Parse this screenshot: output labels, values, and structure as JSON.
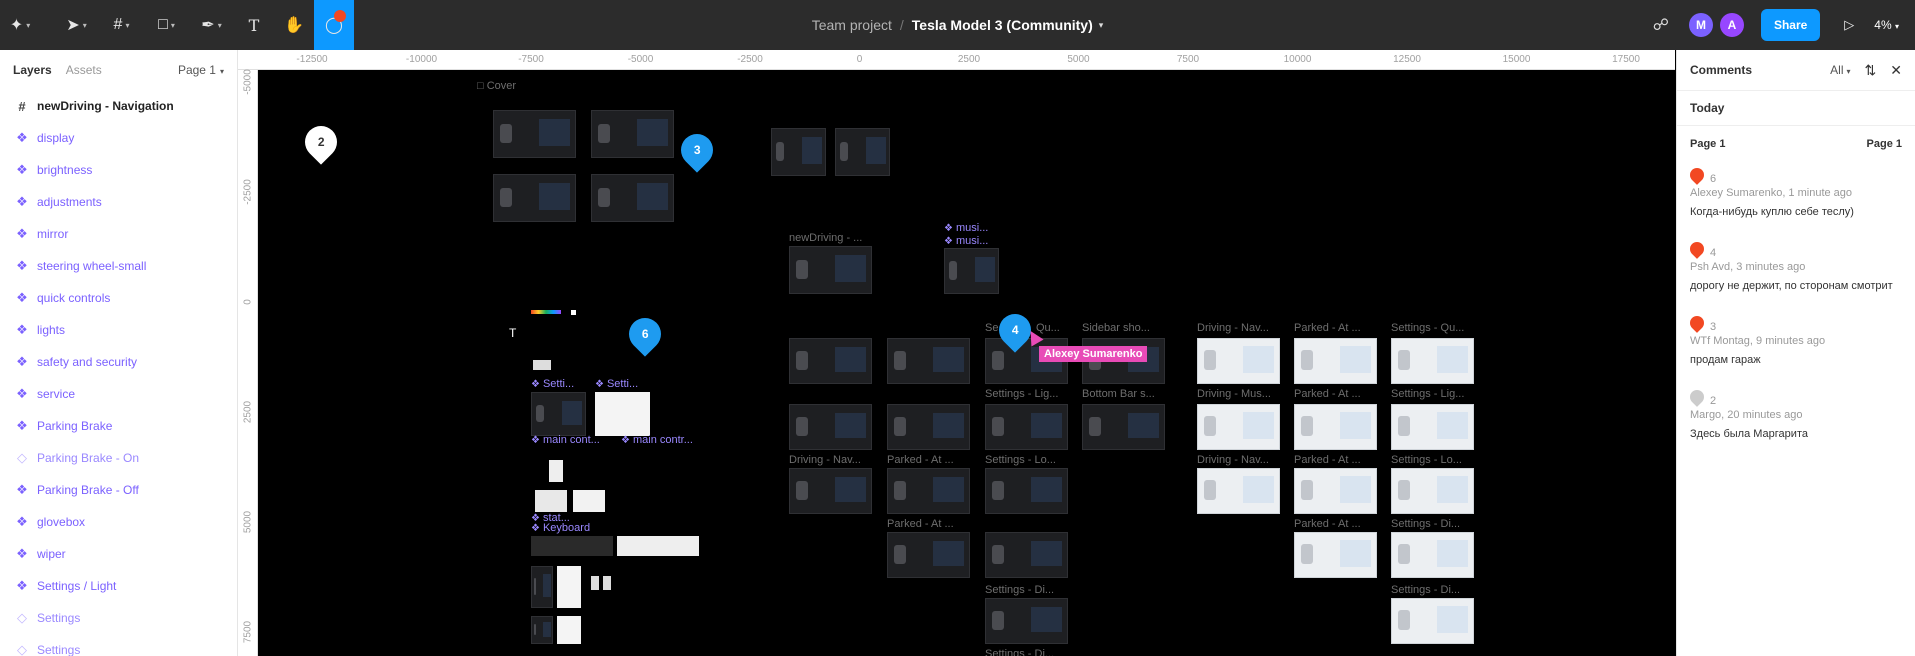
{
  "toolbar": {
    "project": "Team project",
    "separator": "/",
    "file_name": "Tesla Model 3 (Community)",
    "avatars": [
      {
        "initial": "M",
        "color": "#7b61ff"
      },
      {
        "initial": "A",
        "color": "#9747ff"
      }
    ],
    "share_label": "Share",
    "zoom": "4%",
    "accent": "#0d99ff"
  },
  "left_panel": {
    "tabs": [
      "Layers",
      "Assets"
    ],
    "page": "Page 1",
    "layers": [
      {
        "label": "newDriving - Navigation",
        "kind": "frame"
      },
      {
        "label": "display",
        "kind": "component"
      },
      {
        "label": "brightness",
        "kind": "component"
      },
      {
        "label": "adjustments",
        "kind": "component"
      },
      {
        "label": "mirror",
        "kind": "component"
      },
      {
        "label": "steering wheel-small",
        "kind": "component"
      },
      {
        "label": "quick controls",
        "kind": "component"
      },
      {
        "label": "lights",
        "kind": "component"
      },
      {
        "label": "safety and security",
        "kind": "component"
      },
      {
        "label": "service",
        "kind": "component"
      },
      {
        "label": "Parking Brake",
        "kind": "component"
      },
      {
        "label": "Parking Brake - On",
        "kind": "variant"
      },
      {
        "label": "Parking Brake - Off",
        "kind": "component"
      },
      {
        "label": "glovebox",
        "kind": "component"
      },
      {
        "label": "wiper",
        "kind": "component"
      },
      {
        "label": "Settings / Light",
        "kind": "component"
      },
      {
        "label": "Settings",
        "kind": "variant"
      },
      {
        "label": "Settings",
        "kind": "variant"
      }
    ]
  },
  "rulers": {
    "top": [
      "-12500",
      "-10000",
      "-7500",
      "-5000",
      "-2500",
      "0",
      "2500",
      "5000",
      "7500",
      "10000",
      "12500",
      "15000",
      "17500"
    ],
    "left": [
      "-5000",
      "-2500",
      "0",
      "2500",
      "5000",
      "7500"
    ]
  },
  "canvas": {
    "cover_label": "Cover",
    "pins": [
      {
        "num": "2",
        "style": "white"
      },
      {
        "num": "3",
        "style": "blue"
      },
      {
        "num": "6",
        "style": "blue"
      },
      {
        "num": "4",
        "style": "blue"
      }
    ],
    "cursor_user": "Alexey Sumarenko",
    "frame_labels": [
      "newDriving - ...",
      "Se",
      "Qu...",
      "Sidebar sho...",
      "Settings - Lig...",
      "Bottom Bar s...",
      "Driving - Nav...",
      "Parked - At ...",
      "Settings - Lo...",
      "Parked - At ...",
      "Settings - Di...",
      "Settings - Di...",
      "Driving - Nav...",
      "Parked - At ...",
      "Settings - Qu...",
      "Driving - Mus...",
      "Parked - At ...",
      "Settings - Lig...",
      "Driving - Nav...",
      "Parked - At ...",
      "Settings - Lo...",
      "Parked - At ...",
      "Settings - Di...",
      "Settings - Di..."
    ],
    "component_labels": [
      "musi...",
      "musi...",
      "Setti...",
      "Setti...",
      "main cont...",
      "main contr...",
      "stat...",
      "Keyboard"
    ]
  },
  "comments_panel": {
    "title": "Comments",
    "filter": "All",
    "section": "Today",
    "page_label": "Page 1",
    "page_label_right": "Page 1",
    "items": [
      {
        "num": "6",
        "author": "Alexey Sumarenko, 1 minute ago",
        "text": "Когда-нибудь куплю себе теслу)",
        "pin_color": "#f24822"
      },
      {
        "num": "4",
        "author": "Psh Avd, 3 minutes ago",
        "text": "дорогу не держит, по сторонам смотрит",
        "pin_color": "#f24822"
      },
      {
        "num": "3",
        "author": "WTf Montag, 9 minutes ago",
        "text": "продам гараж",
        "pin_color": "#f24822"
      },
      {
        "num": "2",
        "author": "Margo, 20 minutes ago",
        "text": "Здесь была Маргарита",
        "pin_color": "#cccccc"
      }
    ]
  }
}
